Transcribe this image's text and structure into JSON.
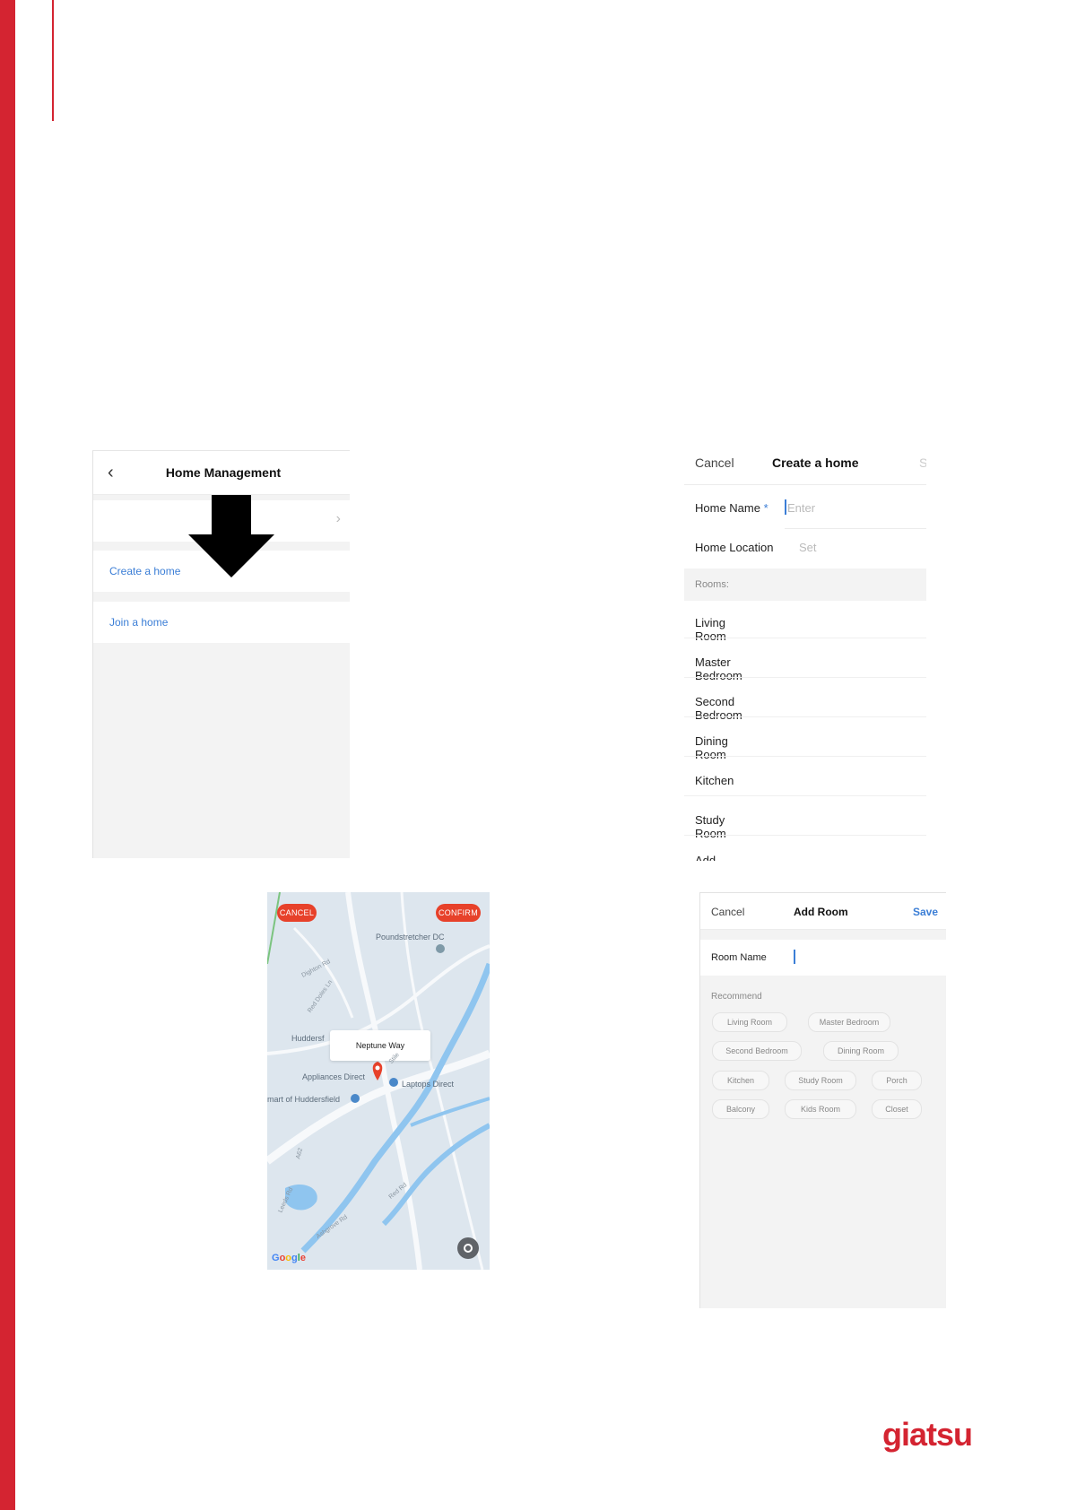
{
  "brand": {
    "logo_text": "giatsu",
    "color": "#d42431"
  },
  "home_management": {
    "title": "Home Management",
    "back_icon": "chevron-left-icon",
    "create_label": "Create a home",
    "join_label": "Join a home"
  },
  "create_home": {
    "cancel": "Cancel",
    "title": "Create a home",
    "save": "S",
    "home_name_label": "Home Name",
    "required_mark": "*",
    "home_name_placeholder": "Enter",
    "home_location_label": "Home Location",
    "home_location_placeholder": "Set",
    "rooms_label": "Rooms:",
    "rooms": [
      "Living Room",
      "Master Bedroom",
      "Second Bedroom",
      "Dining Room",
      "Kitchen",
      "Study Room"
    ],
    "add_room_partial": "Add Room"
  },
  "map": {
    "cancel": "CANCEL",
    "confirm": "CONFIRM",
    "selected_place": "Neptune Way",
    "places": {
      "poundstretcher": "Poundstretcher DC",
      "huddersfield": "Huddersf",
      "appliances": "Appliances Direct",
      "laptops": "Laptops Direct",
      "mart": "mart of Huddersfield",
      "roads": [
        "Dighton Rd",
        "Red Doles Ln",
        "Leeds Rd",
        "Ashgrove Rd",
        "A62",
        "Red Rd",
        "Stile"
      ]
    },
    "google": "Google"
  },
  "add_room": {
    "cancel": "Cancel",
    "title": "Add Room",
    "save": "Save",
    "room_name_label": "Room Name",
    "recommend_label": "Recommend",
    "chips": [
      "Living Room",
      "Master Bedroom",
      "Second Bedroom",
      "Dining Room",
      "Kitchen",
      "Study Room",
      "Porch",
      "Balcony",
      "Kids Room",
      "Closet"
    ]
  }
}
